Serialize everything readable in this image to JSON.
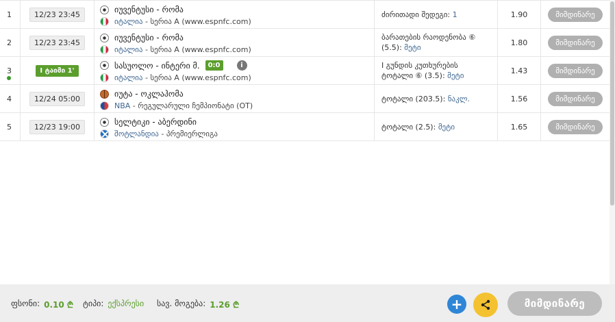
{
  "rows": [
    {
      "num": "1",
      "time": "12/23 23:45",
      "match": "იუვენტუსი - რომა",
      "country": "იტალია",
      "league": "სერია A (www.espnfc.com)",
      "bet_label": "ძირითადი შედეგი:",
      "bet_value": "1",
      "odd": "1.90",
      "action": "მიმდინარე"
    },
    {
      "num": "2",
      "time": "12/23 23:45",
      "match": "იუვენტუსი - რომა",
      "country": "იტალია",
      "league": "სერია A (www.espnfc.com)",
      "bet_label_1": "ბარათების რაოდენობა ⑥",
      "bet_label_2": "(5.5):",
      "bet_value": "მეტი",
      "odd": "1.80",
      "action": "მიმდინარე"
    },
    {
      "num": "3",
      "time": "I ტაიმი 1'",
      "match": "სასუოლო - ინტერი მ.",
      "score": "0:0",
      "info": "i",
      "country": "იტალია",
      "league": "სერია A (www.espnfc.com)",
      "bet_label_1": "I გუნდის კუთხურების",
      "bet_label_2": "ტოტალი ⑥ (3.5):",
      "bet_value": "მეტი",
      "odd": "1.43",
      "action": "მიმდინარე"
    },
    {
      "num": "4",
      "time": "12/24 05:00",
      "match": "იუტა - ოკლაჰომა",
      "country": "NBA",
      "league": "რეგულარული ჩემპიონატი (OT)",
      "bet_label": "ტოტალი (203.5):",
      "bet_value": "ნაკლ.",
      "odd": "1.56",
      "action": "მიმდინარე"
    },
    {
      "num": "5",
      "time": "12/23 19:00",
      "match": "სელტიკი - აბერდინი",
      "country": "შოტლანდია",
      "league": "პრემიერლიგა",
      "bet_label": "ტოტალი (2.5):",
      "bet_value": "მეტი",
      "odd": "1.65",
      "action": "მიმდინარე"
    }
  ],
  "footer": {
    "stake_label": "ფსონი:",
    "stake_value": "0.10 ₾",
    "type_label": "ტიპი:",
    "type_value": "ექსპრესი",
    "win_label": "სავ. მოგება:",
    "win_value": "1.26 ₾",
    "plus": "+",
    "next": "მიმდინარე"
  },
  "colors": {
    "accent_green": "#5b9e2d",
    "blue": "#2f86d6",
    "yellow": "#f4c230",
    "link": "#3e6690"
  }
}
